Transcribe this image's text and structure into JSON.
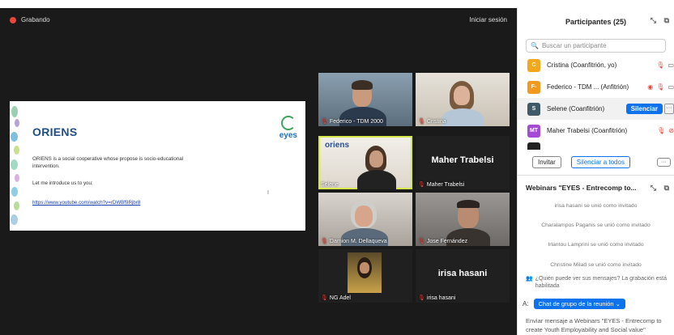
{
  "meeting": {
    "recording_label": "Grabando",
    "signin_label": "Iniciar sesión"
  },
  "slide": {
    "title": "ORIENS",
    "logo_text": "eyes",
    "paragraph": "ORIENS is a social cooperative whose propose is socio-educational intervention.",
    "intro": "Let me introduce us to you:",
    "link": "https://www.youtube.com/watch?v=rDWBf9Rjbr8",
    "cursor_mark": "I"
  },
  "tiles": [
    {
      "name": "Federico - TDM 2000"
    },
    {
      "name": "Cristina"
    },
    {
      "name": "Selene",
      "logo": "oriens"
    },
    {
      "name": "Maher Trabelsi",
      "display": "Maher Trabelsi"
    },
    {
      "name": "Damion M. Dellaqueva"
    },
    {
      "name": "Jose Fernández"
    },
    {
      "name": "NG Adel"
    },
    {
      "name": "irisa hasani",
      "display": "irisa hasani"
    }
  ],
  "participants": {
    "title": "Participantes (25)",
    "search_placeholder": "Buscar un participante",
    "list": [
      {
        "initial": "C",
        "color": "#f4a71d",
        "name": "Cristina (Coanfitrión, yo)"
      },
      {
        "initial": "F-",
        "color": "#f29a1d",
        "name": "Federico - TDM ... (Anfitrión)"
      },
      {
        "initial": "S",
        "color": "#3f5966",
        "name": "Selene (Coanfitrión)"
      },
      {
        "initial": "MT",
        "color": "#a34bd6",
        "name": "Maher Trabelsi (Coanfitrión)"
      }
    ],
    "mute_label": "Silenciar",
    "more_label": "···",
    "invite_label": "Invitar",
    "mute_all_label": "Silenciar a todos"
  },
  "chat": {
    "title": "Webinars \"EYES - Entrecomp to...",
    "messages": [
      "irisa hasani se unió como invitado",
      "Charalampos Paganis se unió como invitado",
      "Irlantou Lamprini se unió como invitado",
      "Christine Milad se unió como invitado"
    ],
    "privacy": "¿Quién puede ver sus mensajes? La grabación está habilitada",
    "to_label": "A:",
    "to_value": "Chat de grupo de la reunión",
    "compose_placeholder": "Enviar mensaje a Webinars \"EYES - Entrecomp to create Youth Employability and Social value\""
  }
}
